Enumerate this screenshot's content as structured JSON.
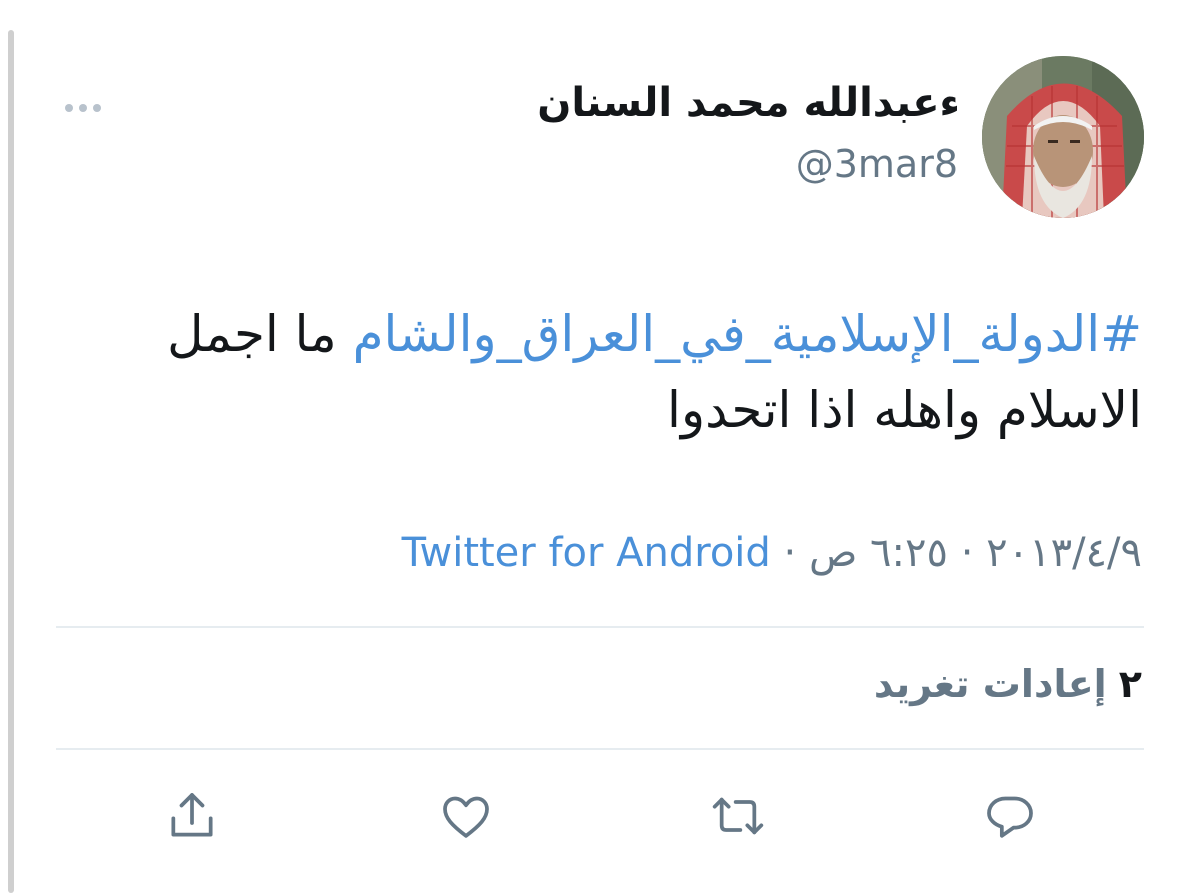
{
  "tweet": {
    "author": {
      "display_name": "ءعبدالله محمد السنان",
      "handle": "@3mar8"
    },
    "text": {
      "hashtag": "#الدولة_الإسلامية_في_العراق_والشام",
      "body": "ما اجمل الاسلام واهله اذا اتحدوا"
    },
    "meta": {
      "date": "٢٠١٣/٤/٩",
      "sep1": "·",
      "time": "٦:٢٥ ص",
      "sep2": "·",
      "source": "Twitter for Android"
    },
    "stats": {
      "retweet_count": "٢",
      "retweet_label": "إعادات تغريد"
    },
    "actions": {
      "reply_icon": "reply-icon",
      "retweet_icon": "retweet-icon",
      "like_icon": "heart-icon",
      "share_icon": "share-icon"
    }
  },
  "colors": {
    "text_primary": "#14171a",
    "text_secondary": "#657786",
    "link": "#4a90d9",
    "divider": "#e6ecf0",
    "icon": "#657786"
  }
}
